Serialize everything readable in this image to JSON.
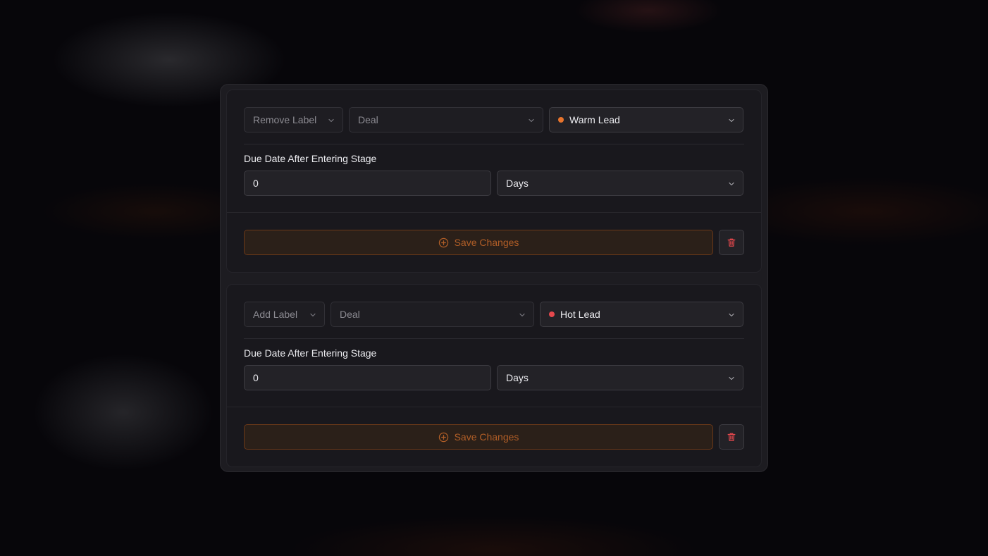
{
  "colors": {
    "accent": "#b15e27",
    "warm_dot": "#e8742c",
    "hot_dot": "#e5484d",
    "danger": "#e5484d"
  },
  "rules": [
    {
      "action_label": "Remove Label",
      "entity_label": "Deal",
      "label_value": "Warm Lead",
      "label_dot_color": "#e8742c",
      "due_date_heading": "Due Date After Entering Stage",
      "due_value": "0",
      "due_unit": "Days",
      "save_label": "Save Changes",
      "delete_icon": "trash-icon"
    },
    {
      "action_label": "Add Label",
      "entity_label": "Deal",
      "label_value": "Hot Lead",
      "label_dot_color": "#e5484d",
      "due_date_heading": "Due Date After Entering Stage",
      "due_value": "0",
      "due_unit": "Days",
      "save_label": "Save Changes",
      "delete_icon": "trash-icon"
    }
  ]
}
